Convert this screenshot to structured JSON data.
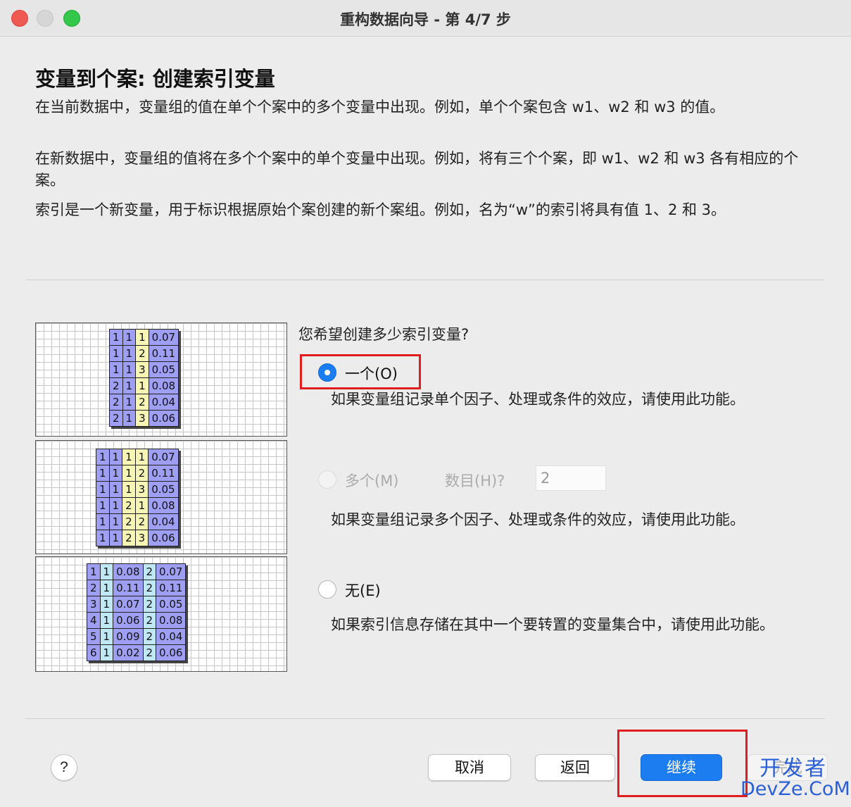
{
  "window": {
    "title": "重构数据向导 - 第 4/7 步"
  },
  "page": {
    "heading": "变量到个案: 创建索引变量",
    "para1": "在当前数据中，变量组的值在单个个案中的多个变量中出现。例如，单个个案包含 w1、w2 和 w3 的值。",
    "para2": "在新数据中，变量组的值将在多个个案中的单个变量中出现。例如，将有三个个案，即 w1、w2 和 w3 各有相应的个案。",
    "para3": "索引是一个新变量，用于标识根据原始个案创建的新个案组。例如，名为“w”的索引将具有值 1、2 和 3。"
  },
  "illustrations": [
    {
      "cell_colors": [
        "p",
        "p",
        "y",
        "p"
      ],
      "rows": [
        [
          "1",
          "1",
          "1",
          "0.07"
        ],
        [
          "1",
          "1",
          "2",
          "0.11"
        ],
        [
          "1",
          "1",
          "3",
          "0.05"
        ],
        [
          "2",
          "1",
          "1",
          "0.08"
        ],
        [
          "2",
          "1",
          "2",
          "0.04"
        ],
        [
          "2",
          "1",
          "3",
          "0.06"
        ]
      ]
    },
    {
      "cell_colors": [
        "p",
        "p",
        "y",
        "y",
        "p"
      ],
      "rows": [
        [
          "1",
          "1",
          "1",
          "1",
          "0.07"
        ],
        [
          "1",
          "1",
          "1",
          "2",
          "0.11"
        ],
        [
          "1",
          "1",
          "1",
          "3",
          "0.05"
        ],
        [
          "1",
          "1",
          "2",
          "1",
          "0.08"
        ],
        [
          "1",
          "1",
          "2",
          "2",
          "0.04"
        ],
        [
          "1",
          "1",
          "2",
          "3",
          "0.06"
        ]
      ]
    },
    {
      "cell_colors": [
        "p",
        "c",
        "p",
        "c",
        "p"
      ],
      "rows": [
        [
          "1",
          "1",
          "0.08",
          "2",
          "0.07"
        ],
        [
          "2",
          "1",
          "0.11",
          "2",
          "0.11"
        ],
        [
          "3",
          "1",
          "0.07",
          "2",
          "0.05"
        ],
        [
          "4",
          "1",
          "0.06",
          "2",
          "0.08"
        ],
        [
          "5",
          "1",
          "0.09",
          "2",
          "0.04"
        ],
        [
          "6",
          "1",
          "0.02",
          "2",
          "0.06"
        ]
      ]
    }
  ],
  "options": {
    "question": "您希望创建多少索引变量?",
    "one": {
      "label": "一个(O)",
      "desc": "如果变量组记录单个因子、处理或条件的效应，请使用此功能。",
      "selected": true
    },
    "multiple": {
      "label": "多个(M)",
      "count_label": "数目(H)?",
      "count_value": "2",
      "desc": "如果变量组记录多个因子、处理或条件的效应，请使用此功能。",
      "enabled": false
    },
    "none": {
      "label": "无(E)",
      "desc": "如果索引信息存储在其中一个要转置的变量集合中，请使用此功能。"
    }
  },
  "buttons": {
    "help": "?",
    "cancel": "取消",
    "back": "返回",
    "next": "继续",
    "finish": "完成"
  },
  "watermark": {
    "top": "开发者",
    "bottom": "DevZe.CoM"
  },
  "colors": {
    "accent": "#1b7df0",
    "highlight": "#e11d1d",
    "grid_purple": "#9e9ef2",
    "grid_yellow": "#f6f5b4",
    "grid_cyan": "#bfe7f4"
  }
}
